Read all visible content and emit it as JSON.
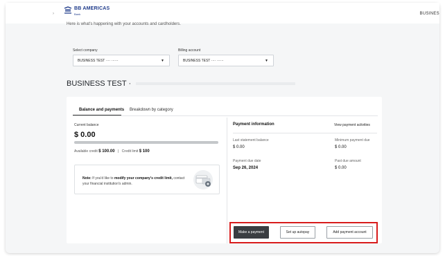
{
  "header": {
    "logo_text": "BB AMERICAS",
    "logo_sub": "Bank",
    "right_label": "BUSINES"
  },
  "subtitle": "Here is what's happening with your accounts and cardholders.",
  "selectors": {
    "company_label": "Select company",
    "company_value": "BUSINESS TEST ···· ······",
    "billing_label": "Billing account",
    "billing_value": "BUSINESS TEST ···· ······"
  },
  "company_title": "BUSINESS TEST ·",
  "tabs": [
    {
      "label": "Balance and payments",
      "active": true
    },
    {
      "label": "Breakdown by category",
      "active": false
    }
  ],
  "balance": {
    "label": "Current balance",
    "value": "$ 0.00",
    "usage_fraction": 0,
    "available_label": "Available credit",
    "available_value": "$ 100.00",
    "separator": "|",
    "limit_label": "Credit limit",
    "limit_value": "$ 100"
  },
  "note": {
    "prefix": "Note:",
    "text_a": " If you'd like to ",
    "emphasis": "modify your company's credit limit,",
    "text_b": " contact your financial institution's admin."
  },
  "payment_info": {
    "title": "Payment information",
    "link": "View payment activities",
    "last_statement_label": "Last statement balance",
    "last_statement_value": "$ 0.00",
    "minimum_label": "Minimum payment due",
    "minimum_value": "$ 0.00",
    "due_date_label": "Payment due date",
    "due_date_value": "Sep 26, 2024",
    "past_due_label": "Past due amount",
    "past_due_value": "$ 0.00"
  },
  "actions": {
    "make_payment": "Make a payment",
    "autopay": "Set up autopay",
    "add_account": "Add payment account"
  },
  "colors": {
    "brand": "#1e3a8a",
    "primary_button": "#3a3d41",
    "highlight": "#d81b1b"
  }
}
